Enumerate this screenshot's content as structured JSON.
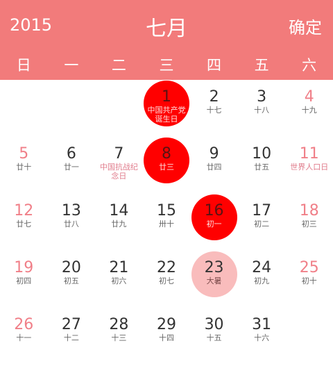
{
  "header": {
    "year": "2015",
    "month": "七月",
    "confirm_label": "确定"
  },
  "weekdays": [
    "日",
    "一",
    "二",
    "三",
    "四",
    "五",
    "六"
  ],
  "colors": {
    "header_bg": "#f27b7b",
    "selected": "#ff0000",
    "today": "#f9bcbc",
    "weekend_text": "#f07f88"
  },
  "days": [
    {
      "day": "1",
      "sub": "中国共产党诞生日",
      "state": "selected",
      "festival": true
    },
    {
      "day": "2",
      "sub": "十七"
    },
    {
      "day": "3",
      "sub": "十八"
    },
    {
      "day": "4",
      "sub": "十九"
    },
    {
      "day": "5",
      "sub": "廿十"
    },
    {
      "day": "6",
      "sub": "廿一"
    },
    {
      "day": "7",
      "sub": "中国抗战纪念日",
      "festival": true
    },
    {
      "day": "8",
      "sub": "廿三",
      "state": "selected"
    },
    {
      "day": "9",
      "sub": "廿四"
    },
    {
      "day": "10",
      "sub": "廿五"
    },
    {
      "day": "11",
      "sub": "世界人口日",
      "festival": true
    },
    {
      "day": "12",
      "sub": "廿七"
    },
    {
      "day": "13",
      "sub": "廿八"
    },
    {
      "day": "14",
      "sub": "廿九"
    },
    {
      "day": "15",
      "sub": "卅十"
    },
    {
      "day": "16",
      "sub": "初一",
      "state": "selected"
    },
    {
      "day": "17",
      "sub": "初二"
    },
    {
      "day": "18",
      "sub": "初三"
    },
    {
      "day": "19",
      "sub": "初四"
    },
    {
      "day": "20",
      "sub": "初五"
    },
    {
      "day": "21",
      "sub": "初六"
    },
    {
      "day": "22",
      "sub": "初七"
    },
    {
      "day": "23",
      "sub": "大暑",
      "state": "today"
    },
    {
      "day": "24",
      "sub": "初九"
    },
    {
      "day": "25",
      "sub": "初十"
    },
    {
      "day": "26",
      "sub": "十一"
    },
    {
      "day": "27",
      "sub": "十二"
    },
    {
      "day": "28",
      "sub": "十三"
    },
    {
      "day": "29",
      "sub": "十四"
    },
    {
      "day": "30",
      "sub": "十五"
    },
    {
      "day": "31",
      "sub": "十六"
    }
  ]
}
